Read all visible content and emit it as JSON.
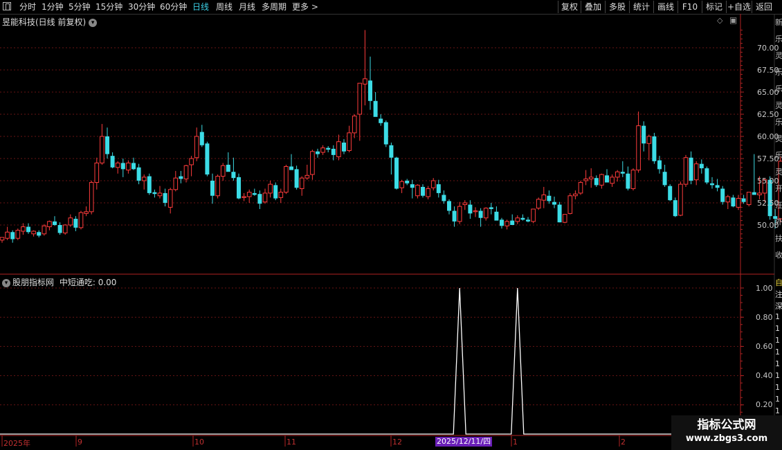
{
  "toolbar": {
    "left_items": [
      "分时",
      "1分钟",
      "5分钟",
      "15分钟",
      "30分钟",
      "60分钟",
      "日线",
      "周线",
      "月线",
      "多周期",
      "更多 >"
    ],
    "active": "日线",
    "right_items": [
      "复权",
      "叠加",
      "多股",
      "统计",
      "画线",
      "F10",
      "标记",
      "+自选",
      "返回"
    ]
  },
  "main_panel": {
    "title": "昱能科技(日线 前复权)",
    "dropdown_glyph": "▾",
    "corner_icons": [
      "◇",
      "▣"
    ]
  },
  "indicator_panel": {
    "title": "股朋指标网",
    "value_label": "中短通吃: 0.00"
  },
  "x_axis": {
    "months": [
      "2025年",
      "9",
      "10",
      "11",
      "12",
      "1",
      "2"
    ],
    "cursor_date": "2025/12/11/四"
  },
  "right_sidebar_glyphs": [
    "新",
    "乐",
    "灵",
    "乐",
    "乐",
    "灵",
    "乐",
    "灵",
    "乐",
    "灵",
    "开",
    "汪",
    "外",
    "扶",
    "收"
  ],
  "right_sidebar_glyphs2": [
    "自",
    "注",
    "深",
    "1",
    "1",
    "1",
    "1",
    "1",
    "1",
    "1",
    "1",
    "1",
    "1",
    "1"
  ],
  "watermark": {
    "line1": "指标公式网",
    "line2": "www.zbgs3.com"
  },
  "colors": {
    "up": "#ff3c3c",
    "down": "#3cdce6",
    "axis": "#b22222",
    "active_tab": "#3cd0e6",
    "date_tag": "#6a1fb8"
  },
  "chart_data": [
    {
      "type": "candlestick",
      "title": "昱能科技(日线 前复权)",
      "ylim": [
        47.0,
        73.5
      ],
      "y_ticks": [
        50.0,
        52.5,
        55.0,
        57.5,
        60.0,
        62.5,
        65.0,
        67.5,
        70.0
      ],
      "y_tick_labels": [
        "50.00",
        "52.50",
        "55.00",
        "57.50",
        "60.00",
        "62.50",
        "65.00",
        "67.50",
        "70.00"
      ],
      "series": [
        {
          "values": [
            [
              48.3,
              48.6,
              48.0,
              48.6
            ],
            [
              48.5,
              49.8,
              48.3,
              49.2
            ],
            [
              49.2,
              49.4,
              48.0,
              48.4
            ],
            [
              48.5,
              49.6,
              48.3,
              49.4
            ],
            [
              49.3,
              50.2,
              48.9,
              49.8
            ],
            [
              49.8,
              50.2,
              49.0,
              49.2
            ],
            [
              49.0,
              49.4,
              48.7,
              49.3
            ],
            [
              49.2,
              49.4,
              48.6,
              48.8
            ],
            [
              49.0,
              50.1,
              48.8,
              49.9
            ],
            [
              49.8,
              50.5,
              49.4,
              50.4
            ],
            [
              50.4,
              51.0,
              49.9,
              50.0
            ],
            [
              50.0,
              50.3,
              48.9,
              49.1
            ],
            [
              49.1,
              50.1,
              48.9,
              50.0
            ],
            [
              50.0,
              51.2,
              49.8,
              50.8
            ],
            [
              50.7,
              51.0,
              49.3,
              49.7
            ],
            [
              49.7,
              51.6,
              49.5,
              51.4
            ],
            [
              51.3,
              52.1,
              51.0,
              51.5
            ],
            [
              51.5,
              55.0,
              51.2,
              54.8
            ],
            [
              54.8,
              57.6,
              54.0,
              57.0
            ],
            [
              57.0,
              61.4,
              56.8,
              60.0
            ],
            [
              60.0,
              61.0,
              57.5,
              58.0
            ],
            [
              57.8,
              58.2,
              56.4,
              56.5
            ],
            [
              56.5,
              57.2,
              55.8,
              57.0
            ],
            [
              57.0,
              57.5,
              55.4,
              56.3
            ],
            [
              56.2,
              57.3,
              55.8,
              57.0
            ],
            [
              57.0,
              57.6,
              56.2,
              56.3
            ],
            [
              56.5,
              56.9,
              54.6,
              55.0
            ],
            [
              55.0,
              55.7,
              54.0,
              55.4
            ],
            [
              55.5,
              55.8,
              53.4,
              53.6
            ],
            [
              53.7,
              54.0,
              53.1,
              53.5
            ],
            [
              53.3,
              54.4,
              53.0,
              53.6
            ],
            [
              53.6,
              54.1,
              52.1,
              52.5
            ],
            [
              52.0,
              54.2,
              51.3,
              54.0
            ],
            [
              54.0,
              56.1,
              53.8,
              55.3
            ],
            [
              55.5,
              56.1,
              54.7,
              55.2
            ],
            [
              55.2,
              56.8,
              54.8,
              56.7
            ],
            [
              56.8,
              57.8,
              55.5,
              57.5
            ],
            [
              57.6,
              61.0,
              57.2,
              60.0
            ],
            [
              60.5,
              61.3,
              58.8,
              59.0
            ],
            [
              59.2,
              59.4,
              55.5,
              55.7
            ],
            [
              55.0,
              55.8,
              52.4,
              53.3
            ],
            [
              53.3,
              55.7,
              53.0,
              55.5
            ],
            [
              55.5,
              57.0,
              55.0,
              56.7
            ],
            [
              56.8,
              58.2,
              56.4,
              56.0
            ],
            [
              56.0,
              57.6,
              55.0,
              55.3
            ],
            [
              55.4,
              55.8,
              52.9,
              53.0
            ],
            [
              53.1,
              53.6,
              52.7,
              53.2
            ],
            [
              53.2,
              54.0,
              52.5,
              53.7
            ],
            [
              53.6,
              54.1,
              53.3,
              53.4
            ],
            [
              53.5,
              53.9,
              51.8,
              52.4
            ],
            [
              52.6,
              54.1,
              52.4,
              53.6
            ],
            [
              53.6,
              55.0,
              53.1,
              54.6
            ],
            [
              54.5,
              54.8,
              52.8,
              53.0
            ],
            [
              53.1,
              54.1,
              52.5,
              53.7
            ],
            [
              53.7,
              56.8,
              53.5,
              56.6
            ],
            [
              56.6,
              58.0,
              56.3,
              56.2
            ],
            [
              56.3,
              56.7,
              54.0,
              54.2
            ],
            [
              54.1,
              55.5,
              53.3,
              55.3
            ],
            [
              55.3,
              56.8,
              55.1,
              55.6
            ],
            [
              55.7,
              58.5,
              55.1,
              58.3
            ],
            [
              58.3,
              58.6,
              57.6,
              58.0
            ],
            [
              58.2,
              59.0,
              57.9,
              58.7
            ],
            [
              58.7,
              58.9,
              58.2,
              58.5
            ],
            [
              58.6,
              59.0,
              57.3,
              57.9
            ],
            [
              57.7,
              60.2,
              57.3,
              59.4
            ],
            [
              59.3,
              59.7,
              58.0,
              58.3
            ],
            [
              58.4,
              61.2,
              58.2,
              60.4
            ],
            [
              60.4,
              62.5,
              59.8,
              62.3
            ],
            [
              62.5,
              63.4,
              59.5,
              66.0
            ],
            [
              65.9,
              72.0,
              63.5,
              66.5
            ],
            [
              66.3,
              69.0,
              63.0,
              64.0
            ],
            [
              64.0,
              65.0,
              62.7,
              62.2
            ],
            [
              62.0,
              62.5,
              61.2,
              61.5
            ],
            [
              61.6,
              61.8,
              58.8,
              59.1
            ],
            [
              59.0,
              59.3,
              55.7,
              57.6
            ],
            [
              57.6,
              57.7,
              54.0,
              54.1
            ],
            [
              54.2,
              55.1,
              53.6,
              54.9
            ],
            [
              55.0,
              55.2,
              54.5,
              54.7
            ],
            [
              54.6,
              55.1,
              53.0,
              54.2
            ],
            [
              53.3,
              54.6,
              53.0,
              54.5
            ],
            [
              54.3,
              54.6,
              53.1,
              53.3
            ],
            [
              53.2,
              54.4,
              52.9,
              54.1
            ],
            [
              54.2,
              55.3,
              53.9,
              55.0
            ],
            [
              54.6,
              55.1,
              53.1,
              53.6
            ],
            [
              53.4,
              53.9,
              52.4,
              52.7
            ],
            [
              52.7,
              52.9,
              51.2,
              51.6
            ],
            [
              51.6,
              52.1,
              49.8,
              50.4
            ],
            [
              50.4,
              52.6,
              50.1,
              52.1
            ],
            [
              52.3,
              52.8,
              51.7,
              52.5
            ],
            [
              52.3,
              52.8,
              50.7,
              51.3
            ],
            [
              51.5,
              52.0,
              50.9,
              51.6
            ],
            [
              51.6,
              51.9,
              49.8,
              50.8
            ],
            [
              50.8,
              52.0,
              50.5,
              51.9
            ],
            [
              52.0,
              52.5,
              51.2,
              51.8
            ],
            [
              51.5,
              52.1,
              50.6,
              50.5
            ],
            [
              50.6,
              50.8,
              49.6,
              49.9
            ],
            [
              49.9,
              50.6,
              49.5,
              50.4
            ],
            [
              50.5,
              51.2,
              50.1,
              50.0
            ],
            [
              50.4,
              51.1,
              50.1,
              50.8
            ],
            [
              50.8,
              51.2,
              50.5,
              50.6
            ],
            [
              50.6,
              50.9,
              50.3,
              50.4
            ],
            [
              50.4,
              51.8,
              50.2,
              51.8
            ],
            [
              51.9,
              53.1,
              51.7,
              52.9
            ],
            [
              52.8,
              54.3,
              51.9,
              53.4
            ],
            [
              53.3,
              53.9,
              52.4,
              52.7
            ],
            [
              52.6,
              53.2,
              51.9,
              52.3
            ],
            [
              52.3,
              52.6,
              50.3,
              50.3
            ],
            [
              50.3,
              50.8,
              50.2,
              51.2
            ],
            [
              51.3,
              53.6,
              51.2,
              53.3
            ],
            [
              53.3,
              53.9,
              52.9,
              53.5
            ],
            [
              53.6,
              55.0,
              53.4,
              54.8
            ],
            [
              55.0,
              56.2,
              54.5,
              55.2
            ],
            [
              55.2,
              56.4,
              54.2,
              55.4
            ],
            [
              55.3,
              55.6,
              54.3,
              54.5
            ],
            [
              54.5,
              55.8,
              54.1,
              55.7
            ],
            [
              55.6,
              56.3,
              55.1,
              54.8
            ],
            [
              54.7,
              55.7,
              54.3,
              55.4
            ],
            [
              55.4,
              56.2,
              54.9,
              56.0
            ],
            [
              56.0,
              57.2,
              55.4,
              55.8
            ],
            [
              55.8,
              56.6,
              53.9,
              54.1
            ],
            [
              54.1,
              56.4,
              53.9,
              56.2
            ],
            [
              56.2,
              62.8,
              55.9,
              61.2
            ],
            [
              61.2,
              61.7,
              58.3,
              59.2
            ],
            [
              59.2,
              60.2,
              57.3,
              60.0
            ],
            [
              60.0,
              60.4,
              56.9,
              57.2
            ],
            [
              57.3,
              57.8,
              55.8,
              56.3
            ],
            [
              56.0,
              56.8,
              54.3,
              54.5
            ],
            [
              54.4,
              54.6,
              52.7,
              52.8
            ],
            [
              52.8,
              53.1,
              50.9,
              51.0
            ],
            [
              51.1,
              54.9,
              51.0,
              54.6
            ],
            [
              54.6,
              57.9,
              54.3,
              57.6
            ],
            [
              57.6,
              58.3,
              54.6,
              55.0
            ],
            [
              55.1,
              57.2,
              54.5,
              56.9
            ],
            [
              56.9,
              57.4,
              55.8,
              56.4
            ],
            [
              56.4,
              56.6,
              54.6,
              54.8
            ],
            [
              54.7,
              55.4,
              54.1,
              54.5
            ],
            [
              54.5,
              55.2,
              53.8,
              54.2
            ],
            [
              54.1,
              54.4,
              52.3,
              52.6
            ],
            [
              52.6,
              53.4,
              51.8,
              53.2
            ],
            [
              53.1,
              53.4,
              52.0,
              52.1
            ],
            [
              52.0,
              53.4,
              51.7,
              53.0
            ],
            [
              53.0,
              53.4,
              52.4,
              52.6
            ],
            [
              52.3,
              53.7,
              52.1,
              53.7
            ],
            [
              53.7,
              58.0,
              53.6,
              53.4
            ],
            [
              53.4,
              55.5,
              52.9,
              53.6
            ],
            [
              53.6,
              55.3,
              52.6,
              55.1
            ],
            [
              55.1,
              55.5,
              50.6,
              51.0
            ],
            [
              51.0,
              51.8,
              49.6,
              50.7
            ],
            [
              50.7,
              57.7,
              50.3,
              57.2
            ]
          ]
        }
      ]
    },
    {
      "type": "line",
      "title": "股朋指标网",
      "ylim": [
        0.0,
        1.05
      ],
      "y_ticks": [
        0.2,
        0.4,
        0.6,
        0.8,
        1.0
      ],
      "y_tick_labels": [
        "0.20",
        "0.40",
        "0.60",
        "0.80",
        "1.00"
      ],
      "series": [
        {
          "name": "中短通吃",
          "signal_days": [
            87,
            98
          ],
          "peak_value": 1.0,
          "last_value": 0.0
        }
      ]
    }
  ]
}
